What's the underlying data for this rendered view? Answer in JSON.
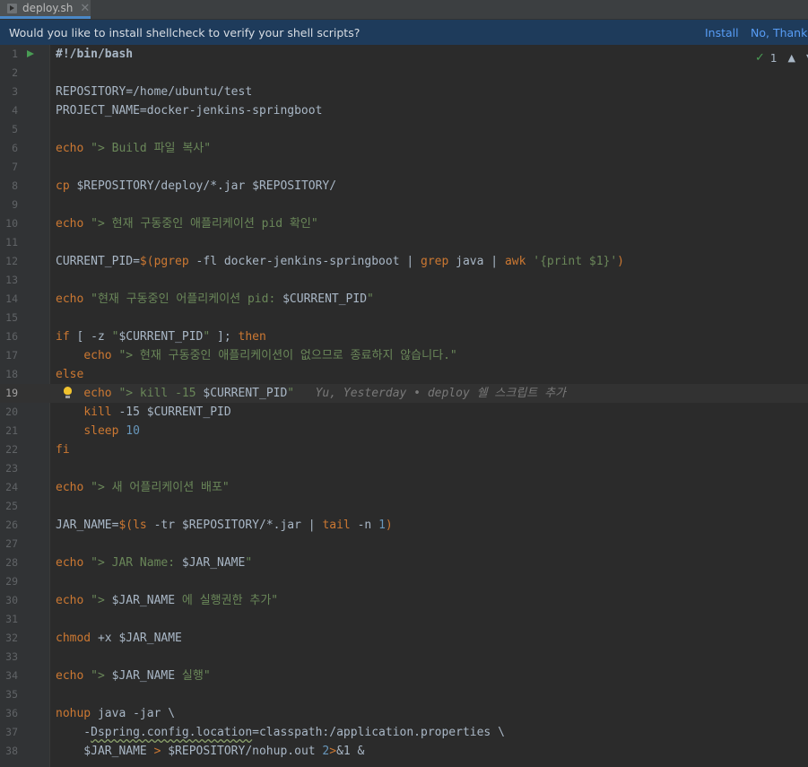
{
  "tab": {
    "filename": "deploy.sh",
    "close": "✕",
    "icon": "shell-script-icon"
  },
  "banner": {
    "message": "Would you like to install shellcheck to verify your shell scripts?",
    "install": "Install",
    "no_thanks": "No, Thanks"
  },
  "inspection": {
    "count": "1",
    "up": "⌃",
    "down": "⌄"
  },
  "current_line": 19,
  "colors": {
    "keyword": "#cc7832",
    "string": "#6a8759",
    "number": "#6897bb",
    "banner_bg": "#1e3b5b",
    "link": "#589df6"
  },
  "lines": [
    {
      "n": "1",
      "t": [
        [
          "bold",
          "#!/bin/bash"
        ]
      ]
    },
    {
      "n": "2",
      "t": []
    },
    {
      "n": "3",
      "t": [
        [
          "var",
          "REPOSITORY=/home/ubuntu/test"
        ]
      ]
    },
    {
      "n": "4",
      "t": [
        [
          "var",
          "PROJECT_NAME=docker-jenkins-springboot"
        ]
      ]
    },
    {
      "n": "5",
      "t": []
    },
    {
      "n": "6",
      "t": [
        [
          "kw",
          "echo "
        ],
        [
          "str",
          "\"> Build 파일 복사\""
        ]
      ]
    },
    {
      "n": "7",
      "t": []
    },
    {
      "n": "8",
      "t": [
        [
          "kw",
          "cp "
        ],
        [
          "var",
          "$REPOSITORY/deploy/*.jar $REPOSITORY/"
        ]
      ]
    },
    {
      "n": "9",
      "t": []
    },
    {
      "n": "10",
      "t": [
        [
          "kw",
          "echo "
        ],
        [
          "str",
          "\"> 현재 구동중인 애플리케이션 pid 확인\""
        ]
      ]
    },
    {
      "n": "11",
      "t": []
    },
    {
      "n": "12",
      "t": [
        [
          "var",
          "CURRENT_PID="
        ],
        [
          "kw",
          "$("
        ],
        [
          "kw",
          "pgrep "
        ],
        [
          "var",
          "-fl docker-jenkins-springboot | "
        ],
        [
          "kw",
          "grep "
        ],
        [
          "var",
          "java | "
        ],
        [
          "kw",
          "awk "
        ],
        [
          "str",
          "'{print $1}'"
        ],
        [
          "kw",
          ")"
        ]
      ]
    },
    {
      "n": "13",
      "t": []
    },
    {
      "n": "14",
      "t": [
        [
          "kw",
          "echo "
        ],
        [
          "str",
          "\"현재 구동중인 어플리케이션 pid: "
        ],
        [
          "var",
          "$CURRENT_PID"
        ],
        [
          "str",
          "\""
        ]
      ]
    },
    {
      "n": "15",
      "t": []
    },
    {
      "n": "16",
      "t": [
        [
          "kw",
          "if "
        ],
        [
          "var",
          "[ -z "
        ],
        [
          "str",
          "\""
        ],
        [
          "var",
          "$CURRENT_PID"
        ],
        [
          "str",
          "\""
        ],
        [
          "var",
          " ]; "
        ],
        [
          "kw",
          "then"
        ]
      ]
    },
    {
      "n": "17",
      "t": [
        [
          "var",
          "    "
        ],
        [
          "kw",
          "echo "
        ],
        [
          "str",
          "\"> 현재 구동중인 애플리케이션이 없으므로 종료하지 않습니다.\""
        ]
      ]
    },
    {
      "n": "18",
      "t": [
        [
          "kw",
          "else"
        ]
      ]
    },
    {
      "n": "19",
      "t": [
        [
          "var",
          "    "
        ],
        [
          "kw",
          "echo "
        ],
        [
          "str",
          "\"> kill -15 "
        ],
        [
          "var",
          "$CURRENT_PID"
        ],
        [
          "str",
          "\""
        ],
        [
          "hint",
          "   Yu, Yesterday • deploy 쉘 스크립트 추가"
        ]
      ]
    },
    {
      "n": "20",
      "t": [
        [
          "var",
          "    "
        ],
        [
          "kw",
          "kill "
        ],
        [
          "var",
          "-15 $CURRENT_PID"
        ]
      ]
    },
    {
      "n": "21",
      "t": [
        [
          "var",
          "    "
        ],
        [
          "kw",
          "sleep "
        ],
        [
          "num",
          "10"
        ]
      ]
    },
    {
      "n": "22",
      "t": [
        [
          "kw",
          "fi"
        ]
      ]
    },
    {
      "n": "23",
      "t": []
    },
    {
      "n": "24",
      "t": [
        [
          "kw",
          "echo "
        ],
        [
          "str",
          "\"> 새 어플리케이션 배포\""
        ]
      ]
    },
    {
      "n": "25",
      "t": []
    },
    {
      "n": "26",
      "t": [
        [
          "var",
          "JAR_NAME="
        ],
        [
          "kw",
          "$("
        ],
        [
          "kw",
          "ls "
        ],
        [
          "var",
          "-tr $REPOSITORY/*.jar | "
        ],
        [
          "kw",
          "tail "
        ],
        [
          "var",
          "-n "
        ],
        [
          "num",
          "1"
        ],
        [
          "kw",
          ")"
        ]
      ]
    },
    {
      "n": "27",
      "t": []
    },
    {
      "n": "28",
      "t": [
        [
          "kw",
          "echo "
        ],
        [
          "str",
          "\"> JAR Name: "
        ],
        [
          "var",
          "$JAR_NAME"
        ],
        [
          "str",
          "\""
        ]
      ]
    },
    {
      "n": "29",
      "t": []
    },
    {
      "n": "30",
      "t": [
        [
          "kw",
          "echo "
        ],
        [
          "str",
          "\"> "
        ],
        [
          "var",
          "$JAR_NAME"
        ],
        [
          "str",
          " 에 실행권한 추가\""
        ]
      ]
    },
    {
      "n": "31",
      "t": []
    },
    {
      "n": "32",
      "t": [
        [
          "kw",
          "chmod "
        ],
        [
          "var",
          "+x $JAR_NAME"
        ]
      ]
    },
    {
      "n": "33",
      "t": []
    },
    {
      "n": "34",
      "t": [
        [
          "kw",
          "echo "
        ],
        [
          "str",
          "\"> "
        ],
        [
          "var",
          "$JAR_NAME"
        ],
        [
          "str",
          " 실행\""
        ]
      ]
    },
    {
      "n": "35",
      "t": []
    },
    {
      "n": "36",
      "t": [
        [
          "kw",
          "nohup "
        ],
        [
          "var",
          "java -jar \\"
        ]
      ]
    },
    {
      "n": "37",
      "t": [
        [
          "var",
          "    -"
        ],
        [
          "squig",
          "Dspring.config.location"
        ],
        [
          "var",
          "=classpath:/application.properties \\"
        ]
      ]
    },
    {
      "n": "38",
      "t": [
        [
          "var",
          "    $JAR_NAME "
        ],
        [
          "kw",
          "> "
        ],
        [
          "var",
          "$REPOSITORY/nohup.out "
        ],
        [
          "num",
          "2"
        ],
        [
          "kw",
          ">"
        ],
        [
          "var",
          "&1 &"
        ]
      ]
    }
  ]
}
